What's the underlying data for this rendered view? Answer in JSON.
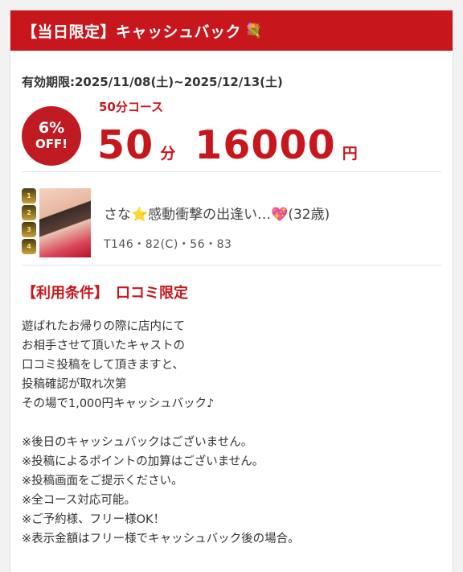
{
  "header": {
    "title": "【当日限定】キャッシュバック",
    "icon": "gift-bouquet-icon"
  },
  "period": "有効期限:2025/11/08(土)~2025/12/13(土)",
  "badge": {
    "pct": "6%",
    "off": "OFF!"
  },
  "course": {
    "label": "50分コース",
    "minutes": "50",
    "minutes_unit": "分",
    "price": "16000",
    "price_unit": "円"
  },
  "cast": {
    "name_prefix": "さな",
    "star_icon": "⭐",
    "name_catch": "感動衝撃の出逢い…",
    "heart_icon": "💖",
    "age": "(32歳)",
    "measurements": "T146・82(C)・56・83",
    "ranks": [
      "1",
      "2",
      "3",
      "4"
    ]
  },
  "conditions": {
    "title": "【利用条件】　口コミ限定",
    "body": [
      "遊ばれたお帰りの際に店内にて",
      "お相手させて頂いたキャストの",
      "口コミ投稿をして頂きますと、",
      "投稿確認が取れ次第",
      "その場で1,000円キャッシュバック♪"
    ],
    "notes": [
      "※後日のキャッシュバックはございません。",
      "※投稿によるポイントの加算はございません。",
      "※投稿画面をご提示ください。",
      "※全コース対応可能。",
      "※ご予約様、フリー様OK！",
      "※表示金額はフリー様でキャッシュバック後の場合。"
    ]
  },
  "colors": {
    "accent": "#c8161d",
    "badge": "#c01a22"
  }
}
